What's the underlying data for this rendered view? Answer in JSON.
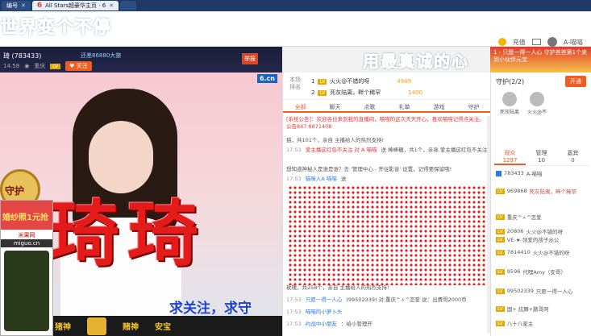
{
  "browser": {
    "tabs": [
      {
        "label": "编号",
        "active": false
      },
      {
        "label": "All Stars超豪华主页 · 6",
        "active": true
      },
      {
        "label": "",
        "active": false
      }
    ]
  },
  "header": {
    "marquee": "世界变个不停",
    "user_coin_label": "充值",
    "username": "A-喵喵"
  },
  "anchor": {
    "name": "琦 (783433)",
    "level": "还差86880大狼",
    "location": "重庆",
    "time": "14:58",
    "follow_label": "关注",
    "report_label": "举报"
  },
  "video": {
    "logo": "6.cn",
    "overlay_big": "琦琦",
    "ribbon": "守护",
    "caption": "求关注，求守",
    "gifts": [
      "猪神",
      "赌神",
      "安宝"
    ]
  },
  "ad": {
    "headline": "婚纱照1元抢",
    "site": "米果网",
    "domain": "miguo.cn"
  },
  "overlay_title": "用最真诚的心",
  "chat": {
    "rank_label": "本场排名",
    "ranks": [
      {
        "pos": "1",
        "name": "火火@不错的呀",
        "value": "4949"
      },
      {
        "pos": "2",
        "name": "死灰陆离，畔个稀罕",
        "value": "1400"
      }
    ],
    "tabs": [
      "全部",
      "聊天",
      "点歌",
      "礼单",
      "游戏",
      "守护"
    ],
    "notice": "[系统公告]：欢迎各位来到我的直播间，喵喵的这次天天开心，喜欢喵喵记得点关注。公告847 8871408",
    "messages": [
      {
        "ts": "",
        "name": "",
        "text": "猫，共101个，亲自 主播给人的热烈支持!"
      },
      {
        "ts": "17:53",
        "name": "爱主播这红包不关注 对 A 喵喵",
        "text": "送 棒棒糖，共1个，亲身 爱主播这红包不关注 的热烈支持!"
      },
      {
        "ts": "",
        "name": "",
        "text": "想知道神秘人是谁是谁？去 '管理中心 - 开往影音' 设置，记得要保留哦!"
      },
      {
        "ts": "17:53",
        "name": "猫咪入A 喵喵",
        "text": "送"
      },
      {
        "ts": "",
        "name": "",
        "text": "玫瑰，共258个，亲自 主播给人的热烈支持!"
      },
      {
        "ts": "17:53",
        "name": "只愿一得一人心",
        "text": "(99502339) 对 重庆^ㅅ^恋爱 说：出费哥2000币"
      },
      {
        "ts": "17:53",
        "name": "喵喵的小萝卜头",
        "text": ""
      },
      {
        "ts": "17:53",
        "name": "约战中小朋友",
        "text": "：给小管理开"
      }
    ]
  },
  "right": {
    "guard_head": "守护(2/2)",
    "open_label": "开通",
    "guards": [
      "死灰陆离",
      "火火@不"
    ],
    "user_tabs": [
      {
        "label": "观众",
        "count": "1297",
        "active": true
      },
      {
        "label": "管理",
        "count": "10",
        "active": false
      },
      {
        "label": "嘉宾",
        "count": "0",
        "active": false
      }
    ],
    "users": [
      {
        "id": "783433",
        "name": "A-喵喵"
      },
      {
        "id": "969868",
        "name": "死灰陆离，畔个稀罕"
      },
      {
        "id": "",
        "name": "重庆^ㅅ^恋爱"
      },
      {
        "id": "20806",
        "name": "火火@不错的呀"
      },
      {
        "id": "",
        "name": "VE-★-领爱的孩子@公"
      },
      {
        "id": "7814410",
        "name": "火火@不错的呀"
      },
      {
        "id": "9596",
        "name": "代哩Amy（安哥）"
      },
      {
        "id": "99502339",
        "name": "只愿一得一人心"
      },
      {
        "id": "",
        "name": "国+ 炫舞+鹏哥阿"
      },
      {
        "id": "",
        "name": "八十八家主"
      }
    ]
  },
  "banner_right": "1 - 只愿一得一人心 守护爸爸第1个来到小伙伴元宝"
}
